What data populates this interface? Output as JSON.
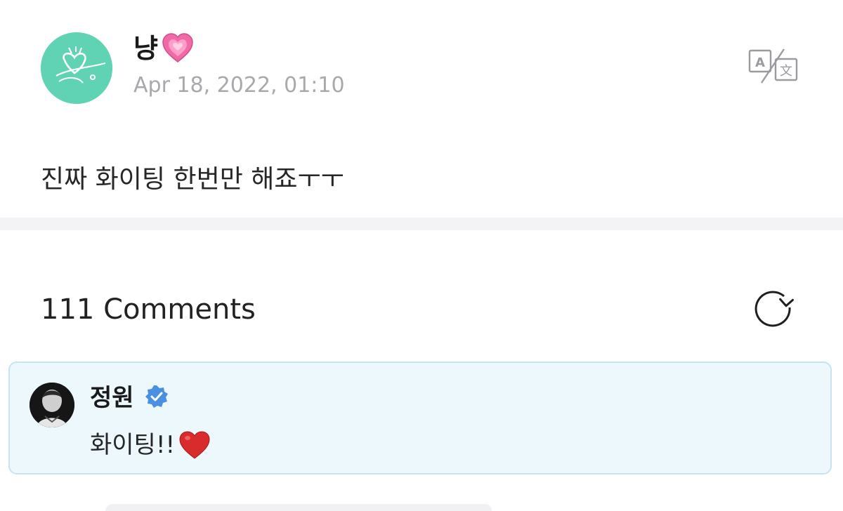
{
  "post": {
    "author": "냥",
    "author_emoji": "growing-heart-emoji",
    "date": "Apr 18, 2022, 01:10",
    "body": "진짜 화이팅 한번만 해죠ㅜㅜ",
    "avatar_color": "#5fd3b4"
  },
  "toolbar": {
    "translate_icon": "translate-icon"
  },
  "comments": {
    "title": "111 Comments",
    "refresh_icon": "refresh-icon",
    "highlighted": {
      "name": "정원",
      "verified_icon": "verified-badge-icon",
      "text": "화이팅!!",
      "trailing_emoji": "red-heart-emoji",
      "card_bg": "#edf8fd",
      "card_border": "#c6e3ee"
    }
  },
  "colors": {
    "date_gray": "#a8a8ad",
    "verified_blue": "#4a90e2",
    "heart_red": "#d92b2b",
    "heart_pink": "#f06aa8"
  }
}
